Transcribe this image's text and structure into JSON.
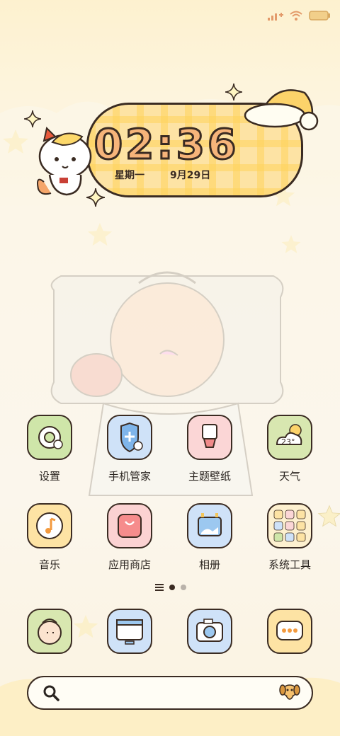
{
  "status_bar": {
    "icons": [
      "signal-icon",
      "wifi-icon",
      "battery-icon"
    ]
  },
  "clock": {
    "time": "02:36",
    "weekday": "星期一",
    "date": "9月29日"
  },
  "apps": [
    {
      "label": "设置",
      "icon": "settings-icon"
    },
    {
      "label": "手机管家",
      "icon": "phone-manager-icon"
    },
    {
      "label": "主题壁纸",
      "icon": "theme-wallpaper-icon"
    },
    {
      "label": "天气",
      "icon": "weather-icon",
      "temp": "23°"
    },
    {
      "label": "音乐",
      "icon": "music-icon"
    },
    {
      "label": "应用商店",
      "icon": "app-store-icon"
    },
    {
      "label": "相册",
      "icon": "gallery-icon"
    },
    {
      "label": "系统工具",
      "icon": "system-tools-folder-icon"
    }
  ],
  "page_indicator": {
    "count": 2,
    "active": 0
  },
  "dock": [
    {
      "icon": "contacts-icon"
    },
    {
      "icon": "browser-icon"
    },
    {
      "icon": "camera-icon"
    },
    {
      "icon": "messages-icon"
    }
  ],
  "search_bar": {
    "icon": "search-icon",
    "mascot": "dog-mascot-icon"
  },
  "colors": {
    "outline": "#3a2b22",
    "accent_yellow": "#fde3a4",
    "digit": "#f6b47a"
  }
}
